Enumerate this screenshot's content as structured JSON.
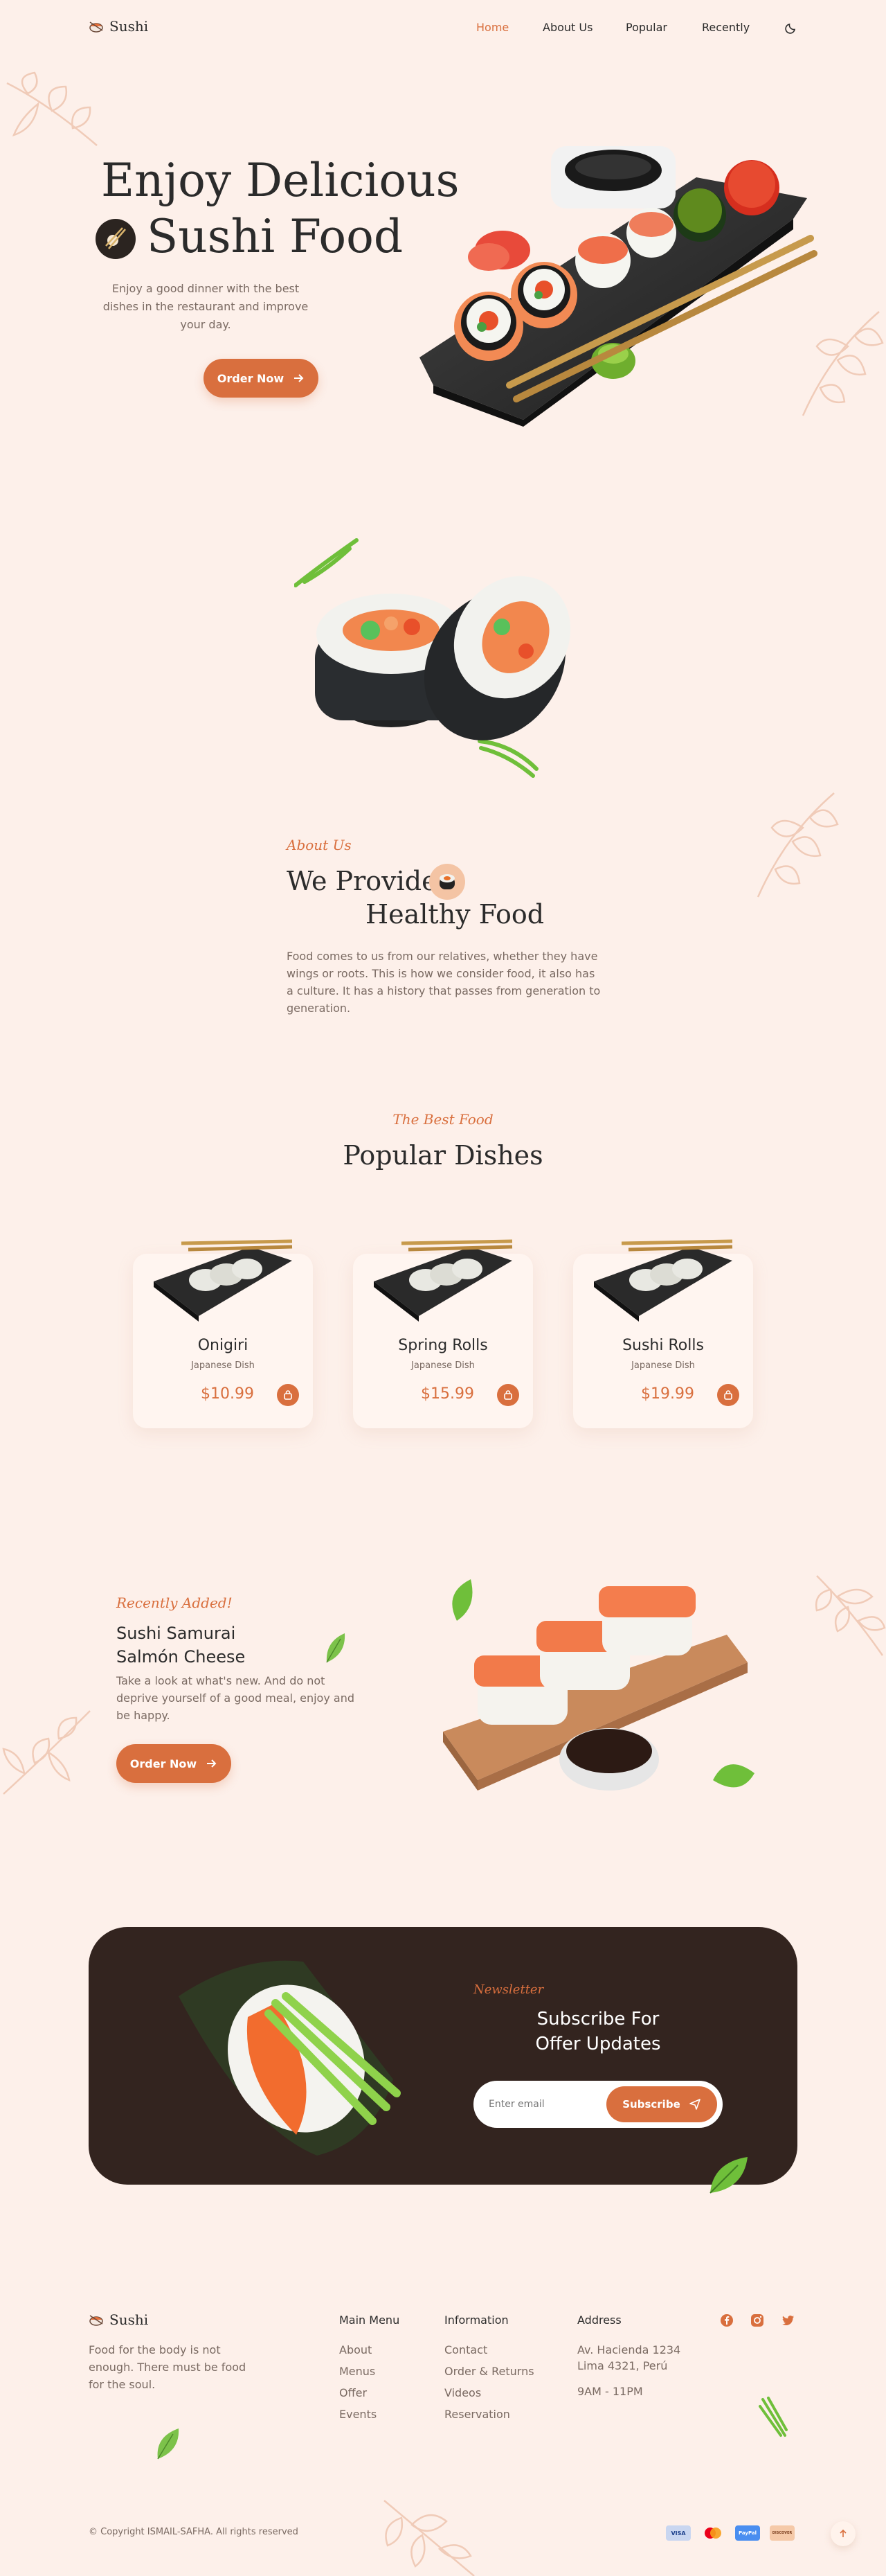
{
  "brand": {
    "name": "Sushi"
  },
  "nav": {
    "items": [
      {
        "label": "Home",
        "active": true
      },
      {
        "label": "About Us",
        "active": false
      },
      {
        "label": "Popular",
        "active": false
      },
      {
        "label": "Recently",
        "active": false
      }
    ],
    "theme_toggle_icon": "moon-icon"
  },
  "hero": {
    "title_line1": "Enjoy Delicious",
    "title_line2": "Sushi Food",
    "description": "Enjoy a good dinner with the best dishes in the restaurant and improve your day.",
    "cta_label": "Order Now"
  },
  "about": {
    "kicker": "About Us",
    "title_line1": "We Provide",
    "title_line2": "Healthy Food",
    "description": "Food comes to us from our relatives, whether they have wings or roots. This is how we consider food, it also has a culture. It has a history that passes from generation to generation."
  },
  "popular": {
    "kicker": "The Best Food",
    "title": "Popular Dishes",
    "dishes": [
      {
        "name": "Onigiri",
        "subtitle": "Japanese Dish",
        "price": "$10.99"
      },
      {
        "name": "Spring Rolls",
        "subtitle": "Japanese Dish",
        "price": "$15.99"
      },
      {
        "name": "Sushi Rolls",
        "subtitle": "Japanese Dish",
        "price": "$19.99"
      }
    ]
  },
  "recently": {
    "kicker": "Recently Added!",
    "title_line1": "Sushi Samurai",
    "title_line2": "Salmón Cheese",
    "description": "Take a look at what's new. And do not deprive yourself of a good meal, enjoy and be happy.",
    "cta_label": "Order Now"
  },
  "newsletter": {
    "kicker": "Newsletter",
    "title_line1": "Subscribe For",
    "title_line2": "Offer Updates",
    "input_placeholder": "Enter email",
    "button_label": "Subscribe"
  },
  "footer": {
    "brand": "Sushi",
    "tagline": "Food for the body is not enough. There must be food for the soul.",
    "columns": [
      {
        "title": "Main Menu",
        "links": [
          "About",
          "Menus",
          "Offer",
          "Events"
        ]
      },
      {
        "title": "Information",
        "links": [
          "Contact",
          "Order & Returns",
          "Videos",
          "Reservation"
        ]
      },
      {
        "title": "Address",
        "links": [
          "Av. Hacienda 1234",
          "Lima 4321, Perú",
          "9AM - 11PM"
        ]
      }
    ],
    "social_icons": [
      "facebook-icon",
      "instagram-icon",
      "twitter-icon"
    ],
    "copyright": "© Copyright ISMAIL-SAFHA. All rights reserved",
    "payments": [
      "VISA",
      "Mastercard",
      "PayPal",
      "DISCOVER"
    ]
  },
  "colors": {
    "accent": "#d96f3e",
    "background": "#fdf0ea",
    "dark": "#33241f"
  }
}
